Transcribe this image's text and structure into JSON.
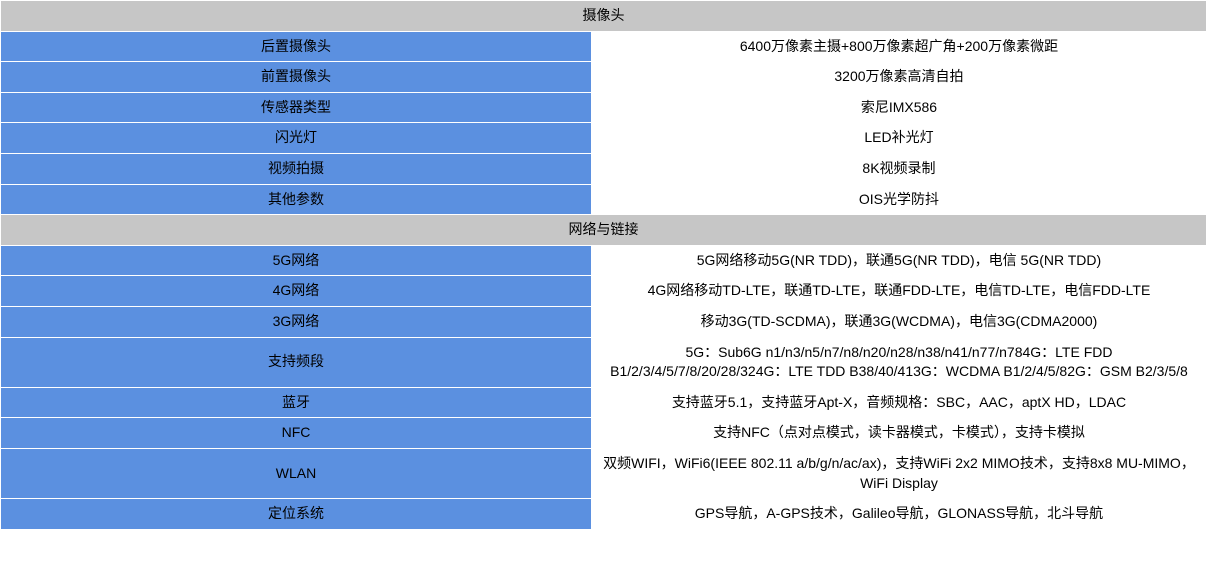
{
  "sections": [
    {
      "title": "摄像头",
      "rows": [
        {
          "label": "后置摄像头",
          "value": "6400万像素主摄+800万像素超广角+200万像素微距"
        },
        {
          "label": "前置摄像头",
          "value": "3200万像素高清自拍"
        },
        {
          "label": "传感器类型",
          "value": "索尼IMX586"
        },
        {
          "label": "闪光灯",
          "value": "LED补光灯"
        },
        {
          "label": "视频拍摄",
          "value": "8K视频录制"
        },
        {
          "label": "其他参数",
          "value": "OIS光学防抖"
        }
      ]
    },
    {
      "title": "网络与链接",
      "rows": [
        {
          "label": "5G网络",
          "value": "5G网络移动5G(NR TDD)，联通5G(NR TDD)，电信 5G(NR TDD)"
        },
        {
          "label": "4G网络",
          "value": "4G网络移动TD-LTE，联通TD-LTE，联通FDD-LTE，电信TD-LTE，电信FDD-LTE"
        },
        {
          "label": "3G网络",
          "value": "移动3G(TD-SCDMA)，联通3G(WCDMA)，电信3G(CDMA2000)"
        },
        {
          "label": "支持频段",
          "value": "5G：Sub6G n1/n3/n5/n7/n8/n20/n28/n38/n41/n77/n784G：LTE FDD B1/2/3/4/5/7/8/20/28/324G：LTE TDD B38/40/413G：WCDMA B1/2/4/5/82G：GSM B2/3/5/8"
        },
        {
          "label": "蓝牙",
          "value": "支持蓝牙5.1，支持蓝牙Apt-X，音频规格：SBC，AAC，aptX HD，LDAC"
        },
        {
          "label": "NFC",
          "value": "支持NFC（点对点模式，读卡器模式，卡模式），支持卡模拟"
        },
        {
          "label": "WLAN",
          "value": "双频WIFI，WiFi6(IEEE 802.11 a/b/g/n/ac/ax)，支持WiFi 2x2 MIMO技术，支持8x8 MU-MIMO，WiFi Display"
        },
        {
          "label": "定位系统",
          "value": "GPS导航，A-GPS技术，Galileo导航，GLONASS导航，北斗导航"
        }
      ]
    }
  ]
}
